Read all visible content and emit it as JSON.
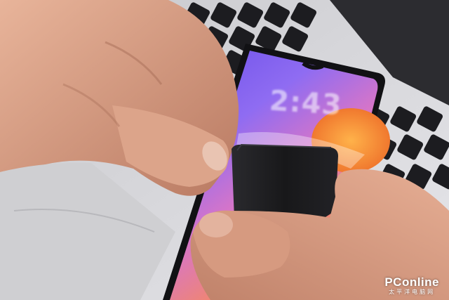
{
  "photo": {
    "subject": "Two hands attaching a black clip to the edge of a smartphone resting on a laptop keyboard",
    "phone_clock": "2:43",
    "colors": {
      "background": "#2a2a2e",
      "laptop_silver": "#d8d8dc",
      "keys": "#1c1c20",
      "screen_purple": "#7a5cf0",
      "screen_orange": "#f29a3a",
      "skin": "#d89a80",
      "clip": "#1a1a1c"
    }
  },
  "watermark": {
    "brand": "PConline",
    "sub": "太平洋电脑网"
  }
}
